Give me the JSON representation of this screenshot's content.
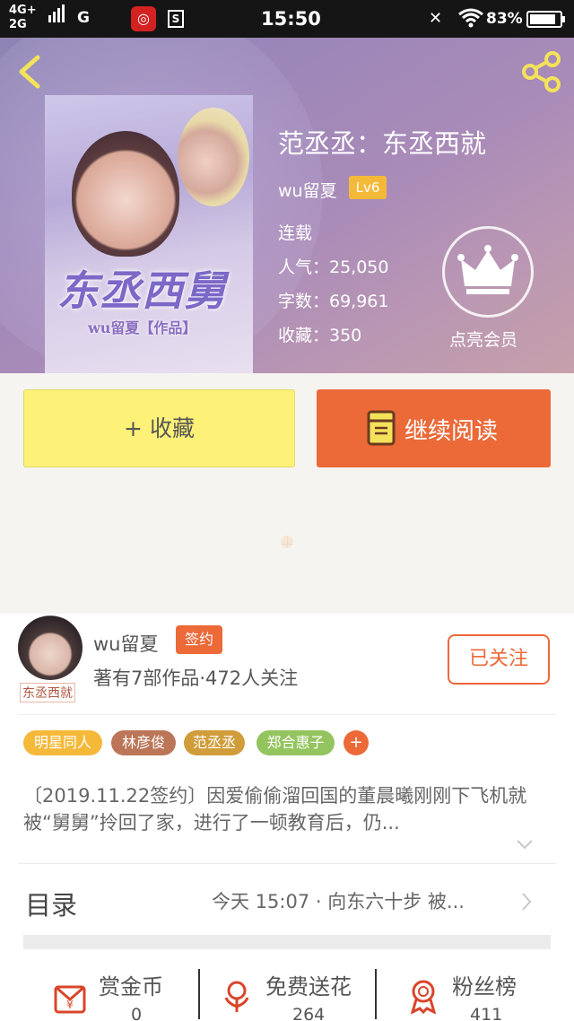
{
  "status_bar": {
    "network_top": "4G+",
    "network_bottom": "2G",
    "network_g": "G",
    "app_icon_2": "S",
    "time": "15:50",
    "battery": "83%"
  },
  "book": {
    "cover_title": "东丞西舅",
    "cover_author": "wu留夏【作品】",
    "title": "范丞丞：东丞西就",
    "author": "wu留夏",
    "level": "Lv6",
    "status": "连载",
    "popularity": "人气：25,050",
    "words": "字数：69,961",
    "favorites": "收藏：350",
    "vip_label": "点亮会员"
  },
  "actions": {
    "favorite": "+ 收藏",
    "continue_reading": "继续阅读"
  },
  "author_card": {
    "name": "wu留夏",
    "sign_badge": "签约",
    "avatar_tag": "东丞西就",
    "works_info": "著有7部作品·472人关注",
    "follow_label": "已关注"
  },
  "tags": [
    "明星同人",
    "林彦俊",
    "范丞丞",
    "郑合惠子"
  ],
  "tag_add": "+",
  "summary": "〔2019.11.22签约〕因爱偷偷溜回国的董晨曦刚刚下飞机就被“舅舅”拎回了家，进行了一顿教育后，仍...",
  "toc": {
    "label": "目录",
    "latest": "今天 15:07 · 向东六十步 被..."
  },
  "stats": [
    {
      "label": "赏金币",
      "value": "0",
      "icon": "gift-coin-icon"
    },
    {
      "label": "免费送花",
      "value": "264",
      "icon": "flower-icon"
    },
    {
      "label": "粉丝榜",
      "value": "411",
      "icon": "medal-icon"
    }
  ],
  "colors": {
    "accent": "#ec6938",
    "favorite_btn": "#fdf178",
    "level_badge": "#f5b93a"
  }
}
